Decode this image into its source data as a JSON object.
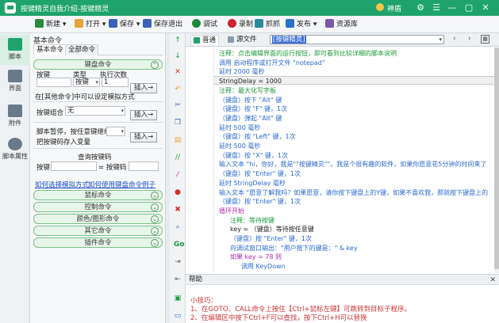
{
  "window": {
    "title": "按键精灵自我介绍-按键精灵",
    "user": "神盾",
    "controls": [
      "⚙",
      "☰",
      "—",
      "▢",
      "✕"
    ]
  },
  "toolbar": [
    {
      "label": "新建",
      "icon": "plus-icon",
      "color": "#2a8a3c"
    },
    {
      "label": "打开",
      "icon": "folder-icon",
      "color": "#e8a43a"
    },
    {
      "label": "保存",
      "icon": "save-icon",
      "color": "#3a62b8"
    },
    {
      "label": "保存退出",
      "icon": "save-exit-icon",
      "color": "#3a62b8"
    },
    {
      "label": "调试",
      "icon": "debug-icon",
      "color": "#1a8a3a"
    },
    {
      "label": "录制",
      "icon": "record-icon",
      "color": "#c23"
    },
    {
      "label": "抓抓",
      "icon": "capture-icon",
      "color": "#2a8a9a"
    },
    {
      "label": "发布",
      "icon": "publish-icon",
      "color": "#2870c8"
    },
    {
      "label": "资源库",
      "icon": "library-icon",
      "color": "#7a5aa8"
    }
  ],
  "sidebar": [
    {
      "label": "脚本",
      "icon": "script-icon",
      "active": true
    },
    {
      "label": "界面",
      "icon": "ui-icon",
      "active": false
    },
    {
      "label": "附件",
      "icon": "attachment-icon",
      "active": false
    },
    {
      "label": "脚本属性",
      "icon": "properties-icon",
      "active": false
    }
  ],
  "panel": {
    "title": "基本命令",
    "tabs": [
      "基本命令",
      "全部命令"
    ],
    "keyboard_group": "键盘命令",
    "col_key": "按键",
    "col_type": "类型",
    "col_count": "执行次数",
    "type_value": "按键",
    "count_value": "1",
    "insert": "插入→",
    "note1": "在[其他命令]中可以设定模拟方式",
    "combo_label": "按键组合",
    "combo_value": "无",
    "pause_label": "脚本暂停，按任意键继续",
    "savekey_label": "把按键码存入变量",
    "query_title": "查询按键码",
    "query_key": "按键",
    "query_code": "= 按键码",
    "link1": "如何选择模拟方式",
    "link2": "如何使用键盘命令",
    "link3": "例子",
    "groups": [
      "鼠标命令",
      "控制命令",
      "颜色/图形命令",
      "其它命令",
      "插件命令"
    ]
  },
  "editor": {
    "tabs": [
      "普通",
      "源文件"
    ],
    "combo_prefix": "[按键精灵]",
    "combo_rest": "",
    "line_color": "#1a9a3a",
    "lines": [
      {
        "t": "注释：点击编辑界面的运行按钮，即可看到比较详细的脚本说明",
        "c": "#1a9a3a",
        "ind": 0
      },
      {
        "t": "调用 启动程序或打开文件 \"notepad\"",
        "c": "#2a6ad0",
        "ind": 0
      },
      {
        "t": "延时 2000 毫秒",
        "c": "#2a6ad0",
        "ind": 0
      },
      {
        "t": "StringDelay = 1000",
        "c": "#222",
        "ind": 0
      },
      {
        "t": "注释：最大化写字板",
        "c": "#1a9a3a",
        "ind": 0
      },
      {
        "t": "（键盘）按下 \"Alt\" 键",
        "c": "#2a6ad0",
        "ind": 0
      },
      {
        "t": "（键盘）按 \"F\" 键，1次",
        "c": "#2a6ad0",
        "ind": 0
      },
      {
        "t": "（键盘）弹起 \"Alt\" 键",
        "c": "#2a6ad0",
        "ind": 0
      },
      {
        "t": "延时 500 毫秒",
        "c": "#2a6ad0",
        "ind": 0
      },
      {
        "t": "（键盘）按 \"Left\" 键，1次",
        "c": "#2a6ad0",
        "ind": 0
      },
      {
        "t": "延时 500 毫秒",
        "c": "#2a6ad0",
        "ind": 0
      },
      {
        "t": "（键盘）按 \"X\" 键，1次",
        "c": "#2a6ad0",
        "ind": 0
      },
      {
        "t": "输入文本 \"hi，你好，我是\"\"按键精灵\"\"。我是个很有趣的软件，如果你愿意花5分钟的时间来了",
        "c": "#2a6ad0",
        "ind": 0
      },
      {
        "t": "（键盘）按 \"Enter\" 键，1次",
        "c": "#2a6ad0",
        "ind": 0
      },
      {
        "t": "延时 StringDelay 毫秒",
        "c": "#2a6ad0",
        "ind": 0
      },
      {
        "t": "输入文本 \"愿意了解我吗？如果愿意，请你按下键盘上的Y键，如果不喜欢我，那就按下键盘上的",
        "c": "#2a6ad0",
        "ind": 0
      },
      {
        "t": "（键盘）按 \"Enter\" 键，1次",
        "c": "#2a6ad0",
        "ind": 0
      },
      {
        "t": "循环开始",
        "c": "#b02ab0",
        "ind": 0
      },
      {
        "t": "注释：等待按键",
        "c": "#1a9a3a",
        "ind": 1
      },
      {
        "t": "key = （键盘）等待按任意键",
        "c": "#222",
        "ind": 1
      },
      {
        "t": "（键盘）按 \"Enter\" 键，1次",
        "c": "#2a6ad0",
        "ind": 1
      },
      {
        "t": "向调试窗口输出：\"用户按下的键是：\" & key",
        "c": "#2a6ad0",
        "ind": 1
      },
      {
        "t": "如果 key = 78 则",
        "c": "#b02ab0",
        "ind": 1
      },
      {
        "t": "调用 KeyDown",
        "c": "#2a6ad0",
        "ind": 2
      }
    ]
  },
  "help": {
    "title": "帮助",
    "tip_title": "小技巧：",
    "tip1": "1、在GOTO、CALL命令上按住【Ctrl+鼠标左键】可跳转到目标子程序。",
    "tip2": "2、在编辑区中按下Ctrl+F可以查找，按下Ctrl+H可以替换"
  }
}
